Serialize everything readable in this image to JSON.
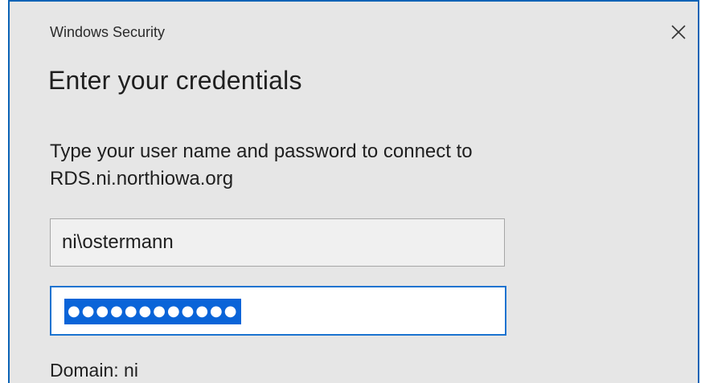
{
  "window": {
    "title": "Windows Security",
    "close_icon": "close-icon"
  },
  "dialog": {
    "heading": "Enter your credentials",
    "description_line1": "Type your user name and password to connect to",
    "description_line2": "RDS.ni.northiowa.org",
    "username_value": "ni\\ostermann",
    "password_masked": "●●●●●●●●●●●●",
    "domain_text": "Domain: ni"
  },
  "colors": {
    "accent": "#0b63b6",
    "selection": "#0a64d8",
    "dialog_bg": "#e6e6e6"
  }
}
